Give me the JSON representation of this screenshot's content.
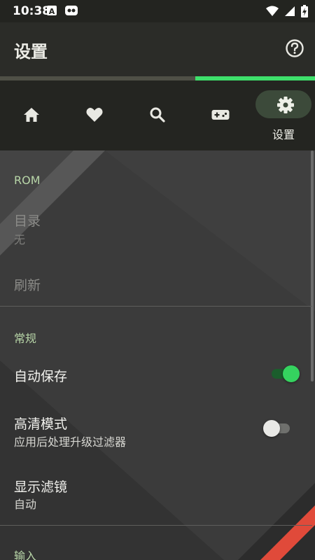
{
  "status_bar": {
    "time": "10:38",
    "left_icons": [
      "notification-a-icon",
      "notification-face-icon"
    ],
    "right_icons": [
      "wifi-icon",
      "cell-signal-icon",
      "battery-charging-icon"
    ]
  },
  "app_bar": {
    "title": "设置",
    "help_icon": "help-circle-icon"
  },
  "progress": {
    "fraction": 0.62,
    "color": "#3ee06b"
  },
  "nav": {
    "items": [
      {
        "id": "home",
        "icon": "home-icon",
        "label": "",
        "active": false
      },
      {
        "id": "favorites",
        "icon": "heart-icon",
        "label": "",
        "active": false
      },
      {
        "id": "search",
        "icon": "search-icon",
        "label": "",
        "active": false
      },
      {
        "id": "games",
        "icon": "gamepad-icon",
        "label": "",
        "active": false
      },
      {
        "id": "settings",
        "icon": "gear-icon",
        "label": "设置",
        "active": true
      }
    ]
  },
  "sections": {
    "rom": {
      "header": "ROM",
      "directory": {
        "title": "目录",
        "summary": "无"
      },
      "refresh": {
        "title": "刷新"
      }
    },
    "general": {
      "header": "常规",
      "autosave": {
        "title": "自动保存",
        "enabled": true
      },
      "hd_mode": {
        "title": "高清模式",
        "summary": "应用后处理升级过滤器",
        "enabled": false
      },
      "filter": {
        "title": "显示滤镜",
        "summary": "自动"
      }
    },
    "input": {
      "header": "输入"
    }
  },
  "colors": {
    "accent": "#3ee06b",
    "section_header": "#b8d6a8",
    "background": "#3a3a3a",
    "red_stripe": "#e04a3a"
  }
}
